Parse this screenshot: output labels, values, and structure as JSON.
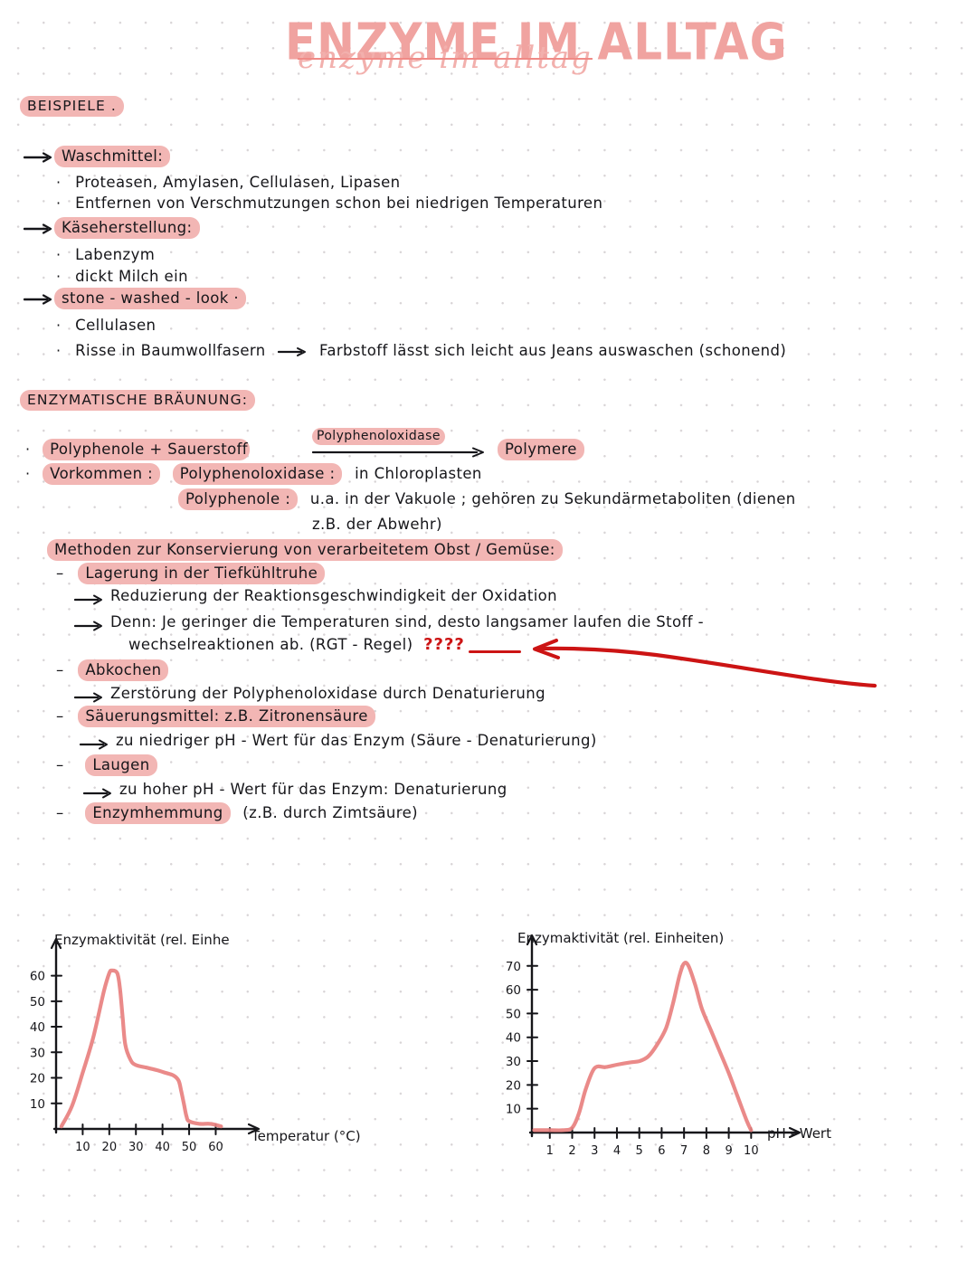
{
  "title": {
    "main": "ENZYME IM ALLTAG",
    "script_overlay": "enzyme im alltag"
  },
  "colors": {
    "highlight_pink": "#f2b6b4",
    "title_pink": "#f0a3a0",
    "curve_pink": "#e8807f",
    "annotation_red": "#cc1414",
    "ink": "#16161a",
    "dot_grid": "#d8d4d6"
  },
  "sections": {
    "beispiele": {
      "heading": "BEISPIELE .",
      "items": [
        {
          "heading": "Waschmittel:",
          "bullets": [
            "Proteasen, Amylasen, Cellulasen, Lipasen",
            "Entfernen von Verschmutzungen schon bei niedrigen Temperaturen"
          ]
        },
        {
          "heading": "Käseherstellung:",
          "bullets": [
            "Labenzym",
            "dickt Milch ein"
          ]
        },
        {
          "heading": "stone - washed - look ·",
          "bullets": [
            "Cellulasen",
            "Risse in Baumwollfasern"
          ],
          "bullet2_arrow_text": "Farbstoff lässt sich leicht aus Jeans auswaschen (schonend)"
        }
      ]
    },
    "braunung": {
      "heading": "ENZYMATISCHE BRÄUNUNG:",
      "reaction": {
        "left": "Polyphenole + Sauerstoff",
        "catalyst": "Polyphenoloxidase",
        "right": "Polymere"
      },
      "vorkommen": {
        "label": "Vorkommen :",
        "line1_key": "Polyphenoloxidase :",
        "line1_val": "in Chloroplasten",
        "line2_key": "Polyphenole :",
        "line2_val": "u.a. in der Vakuole ; gehören zu Sekundärmetaboliten (dienen",
        "line3_val": "z.B. der Abwehr)"
      },
      "methoden_heading": "Methoden zur Konservierung von verarbeitetem Obst / Gemüse:",
      "methoden": [
        {
          "label": "Lagerung in der Tiefkühltruhe",
          "sub": [
            "Reduzierung der Reaktionsgeschwindigkeit der Oxidation",
            "Denn: Je geringer die Temperaturen sind, desto langsamer laufen die Stoff -"
          ],
          "sub_cont": "wechselreaktionen ab. (RGT - Regel)",
          "annotation": "????"
        },
        {
          "label": "Abkochen",
          "sub": [
            "Zerstörung der Polyphenoloxidase durch Denaturierung"
          ]
        },
        {
          "label": "Säuerungsmittel: z.B. Zitronensäure",
          "sub": [
            "zu niedriger pH - Wert für das Enzym (Säure - Denaturierung)"
          ]
        },
        {
          "label": "Laugen",
          "sub": [
            "zu hoher pH - Wert für das Enzym: Denaturierung"
          ]
        },
        {
          "label": "Enzymhemmung",
          "trailing": "(z.B. durch Zimtsäure)",
          "sub": []
        }
      ]
    }
  },
  "chart_data": [
    {
      "type": "line",
      "title": "Enzymaktivität (rel. Einhe",
      "ylabel": "Enzymaktivität (rel. Einhe",
      "xlabel": "Temperatur (°C)",
      "xticks": [
        10,
        20,
        30,
        40,
        50,
        60
      ],
      "yticks": [
        10,
        20,
        30,
        40,
        50,
        60
      ],
      "xlim": [
        0,
        68
      ],
      "ylim": [
        0,
        68
      ],
      "grid": false,
      "legend": "none",
      "x": [
        2,
        6,
        10,
        14,
        18,
        20,
        21,
        23,
        24,
        25,
        26,
        28,
        30,
        34,
        38,
        41,
        44,
        46,
        47,
        48,
        49,
        50,
        54,
        58,
        62
      ],
      "y": [
        1,
        9,
        22,
        36,
        54,
        61,
        62,
        61,
        55,
        44,
        33,
        27,
        25,
        24,
        23,
        22,
        21,
        19,
        15,
        10,
        5,
        3,
        2,
        2,
        1
      ]
    },
    {
      "type": "line",
      "title": "Enzymaktivität (rel. Einheiten)",
      "ylabel": "Enzymaktivität (rel. Einheiten)",
      "xlabel": "pH - Wert",
      "xticks": [
        1,
        2,
        3,
        4,
        5,
        6,
        7,
        8,
        9,
        10
      ],
      "yticks": [
        10,
        20,
        30,
        40,
        50,
        60,
        70
      ],
      "xlim": [
        0.2,
        11.2
      ],
      "ylim": [
        0,
        76
      ],
      "grid": false,
      "legend": "none",
      "x": [
        0.3,
        1.0,
        1.6,
        2.0,
        2.3,
        2.6,
        3.0,
        3.5,
        4.0,
        4.6,
        5.0,
        5.4,
        5.8,
        6.2,
        6.5,
        6.8,
        7.0,
        7.2,
        7.5,
        7.8,
        8.2,
        8.6,
        9.0,
        9.4,
        9.8,
        10.0
      ],
      "y": [
        1,
        1,
        1,
        2,
        8,
        18,
        27,
        27.5,
        28.5,
        29.5,
        30,
        32,
        37,
        44,
        54,
        66,
        71,
        70,
        62,
        52,
        43,
        34,
        25,
        15,
        5,
        1
      ]
    }
  ]
}
